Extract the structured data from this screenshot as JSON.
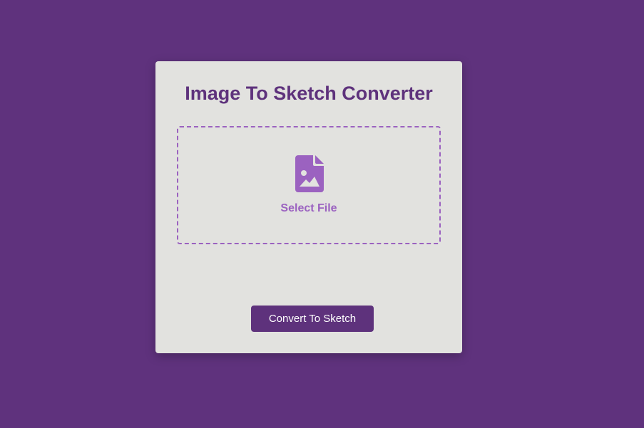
{
  "app": {
    "title": "Image To Sketch Converter"
  },
  "upload": {
    "icon": "file-image-icon",
    "label": "Select File"
  },
  "actions": {
    "convert_label": "Convert To Sketch"
  },
  "colors": {
    "background": "#5f327d",
    "card": "#e2e2df",
    "accent": "#9b62c0",
    "primary": "#5e327c"
  }
}
